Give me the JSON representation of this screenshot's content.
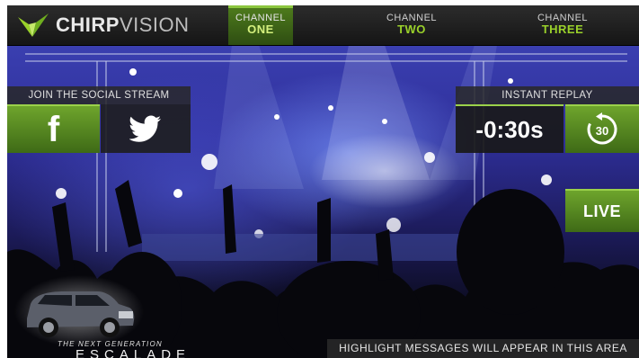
{
  "brand": {
    "name_bold": "CHIRP",
    "name_light": "VISION"
  },
  "channels": [
    {
      "top": "CHANNEL",
      "bottom": "ONE",
      "active": true
    },
    {
      "top": "CHANNEL",
      "bottom": "TWO",
      "active": false
    },
    {
      "top": "CHANNEL",
      "bottom": "THREE",
      "active": false
    }
  ],
  "social": {
    "label": "JOIN THE SOCIAL STREAM",
    "facebook_glyph": "f",
    "facebook_icon": "facebook-icon",
    "twitter_icon": "twitter-bird-icon"
  },
  "replay": {
    "label": "INSTANT REPLAY",
    "time": "-0:30s",
    "button_value": "30",
    "button_icon": "rewind-30-icon"
  },
  "live": {
    "label": "LIVE"
  },
  "ad": {
    "tagline": "THE NEXT GENERATION",
    "model": "ESCALADE"
  },
  "highlight": {
    "text": "HIGHLIGHT MESSAGES WILL APPEAR IN THIS AREA"
  },
  "colors": {
    "accent": "#8cc63f",
    "accent_dark": "#3e6a16",
    "panel": "#1e1e1e"
  }
}
